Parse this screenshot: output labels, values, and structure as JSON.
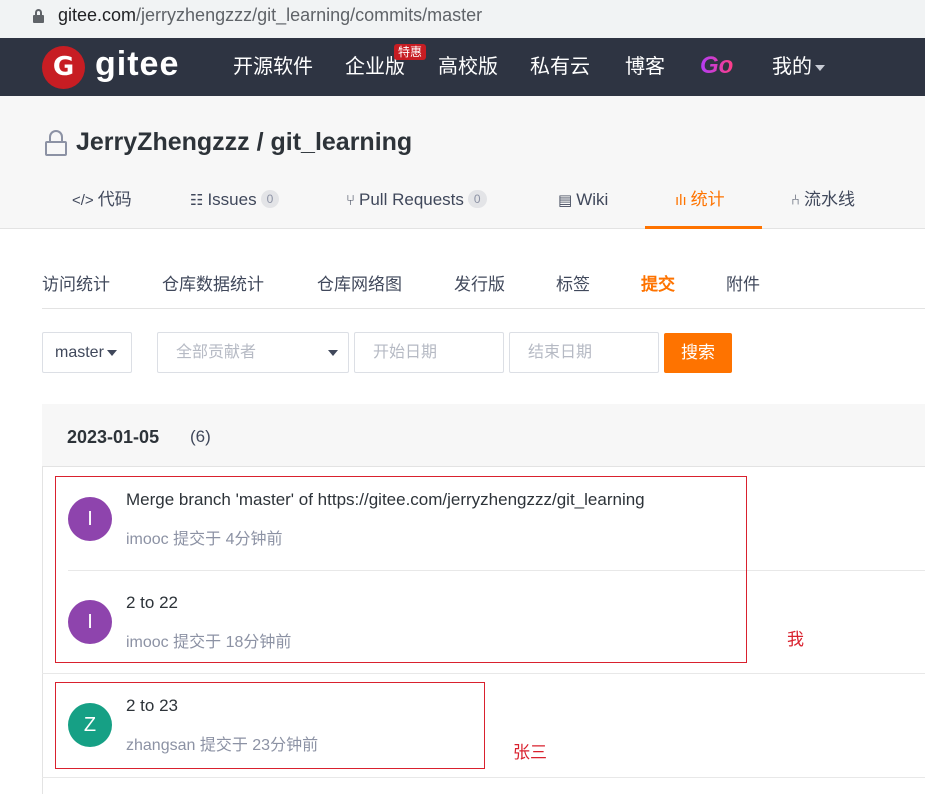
{
  "browser": {
    "url_host": "gitee.com",
    "url_path": "/jerryzhengzzz/git_learning/commits/master"
  },
  "nav": {
    "brand": "gitee",
    "items": [
      "开源软件",
      "企业版",
      "高校版",
      "私有云",
      "博客"
    ],
    "hot_badge": "特惠",
    "go": "Go",
    "mine": "我的"
  },
  "repo": {
    "title": "JerryZhengzzz / git_learning",
    "tabs": {
      "code": "代码",
      "issues": "Issues",
      "issues_count": "0",
      "pulls": "Pull Requests",
      "pulls_count": "0",
      "wiki": "Wiki",
      "stats": "统计",
      "pipeline": "流水线"
    }
  },
  "subtabs": [
    "访问统计",
    "仓库数据统计",
    "仓库网络图",
    "发行版",
    "标签",
    "提交",
    "附件"
  ],
  "filters": {
    "branch": "master",
    "contributors_placeholder": "全部贡献者",
    "start_date_placeholder": "开始日期",
    "end_date_placeholder": "结束日期",
    "search_label": "搜索"
  },
  "commit_group": {
    "date": "2023-01-05",
    "count": "(6)"
  },
  "commits": [
    {
      "avatar": "I",
      "message": "Merge branch 'master' of https://gitee.com/jerryzhengzzz/git_learning",
      "meta": "imooc 提交于 4分钟前",
      "avatar_color": "#8e44ad"
    },
    {
      "avatar": "I",
      "message": "2 to 22",
      "meta": "imooc 提交于 18分钟前",
      "avatar_color": "#8e44ad"
    },
    {
      "avatar": "Z",
      "message": "2 to 23",
      "meta": "zhangsan 提交于 23分钟前",
      "avatar_color": "#16a085"
    }
  ],
  "annotations": {
    "me": "我",
    "zhangsan": "张三"
  },
  "colors": {
    "accent": "#fe7300",
    "nav_bg": "#2e3442",
    "annotation_red": "#d9212e"
  }
}
